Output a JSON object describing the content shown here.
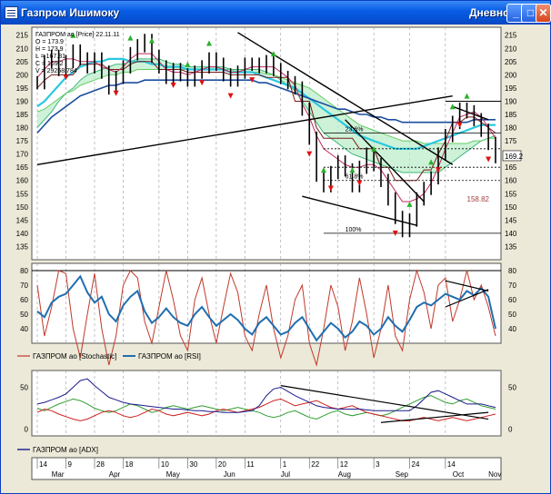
{
  "window": {
    "title": "Газпром Ишимоку",
    "timeframe": "Дневной",
    "min_glyph": "_",
    "max_glyph": "□",
    "close_glyph": "✕"
  },
  "colors": {
    "close": "#000000",
    "cloud": "#3cb878",
    "blue_ma": "#1a4ea0",
    "cyan_ma": "#29c8e0",
    "kijun": "#7a1a1a",
    "tenkan": "#c02860",
    "stoch": "#c0392b",
    "rsi": "#1f6fb0",
    "adx": "#1a1a8a",
    "di_plus": "#2e9e2e",
    "di_minus": "#d02020",
    "up_arrow": "#2ab02a",
    "down_arrow": "#e01010"
  },
  "chart_data": [
    {
      "type": "line",
      "title": "ГАЗПРОМ ао [Price] 22.11.11",
      "info": [
        "O = 173.9",
        "H = 173.9",
        "L = 167.81",
        "C = 169.2",
        "V = 29258.784"
      ],
      "ylim": [
        130,
        218
      ],
      "yticks": [
        215,
        210,
        205,
        200,
        195,
        190,
        185,
        180,
        175,
        170,
        165,
        160,
        155,
        150,
        145,
        140,
        135
      ],
      "series": [
        {
          "role": "close",
          "values": [
            197,
            205,
            207,
            202,
            205,
            209,
            206,
            203,
            206,
            201,
            195,
            199,
            203,
            208,
            211,
            213,
            207,
            203,
            199,
            202,
            200,
            198,
            201,
            203,
            206,
            204,
            200,
            198,
            201,
            204,
            204,
            203,
            205,
            202,
            199,
            197,
            195,
            187,
            176,
            162,
            158,
            163,
            167,
            164,
            158,
            165,
            170,
            166,
            160,
            153,
            146,
            141,
            145,
            153,
            157,
            161,
            170,
            177,
            182,
            187,
            186,
            183,
            179,
            174,
            169
          ]
        },
        {
          "role": "blue_ma",
          "values": [
            178,
            181,
            184,
            186,
            188,
            190,
            192,
            193,
            194,
            195,
            196,
            196,
            197,
            197,
            197,
            198,
            198,
            198,
            198,
            198,
            198,
            198,
            198,
            198,
            198,
            198,
            198,
            198,
            198,
            198,
            198,
            197,
            197,
            196,
            195,
            194,
            193,
            192,
            191,
            190,
            189,
            188,
            187,
            187,
            186,
            185,
            185,
            184,
            184,
            183,
            183,
            182,
            182,
            182,
            182,
            182,
            182,
            182,
            182,
            182,
            182,
            183,
            183,
            183,
            183
          ]
        },
        {
          "role": "cyan_ma",
          "values": [
            188,
            190,
            193,
            196,
            199,
            201,
            203,
            204,
            205,
            205,
            206,
            206,
            206,
            205,
            205,
            205,
            204,
            204,
            203,
            203,
            203,
            202,
            202,
            202,
            202,
            202,
            202,
            201,
            201,
            201,
            201,
            200,
            199,
            198,
            197,
            196,
            195,
            193,
            191,
            189,
            187,
            185,
            183,
            181,
            179,
            177,
            176,
            175,
            174,
            173,
            172,
            172,
            172,
            172,
            173,
            174,
            175,
            176,
            177,
            178,
            179,
            180,
            181,
            181,
            181
          ]
        },
        {
          "role": "kijun",
          "values": [
            195,
            198,
            200,
            200,
            200,
            200,
            204,
            204,
            204,
            204,
            202,
            202,
            202,
            204,
            205,
            205,
            205,
            202,
            202,
            202,
            202,
            201,
            201,
            201,
            201,
            201,
            201,
            200,
            200,
            200,
            200,
            200,
            199,
            199,
            199,
            199,
            190,
            190,
            190,
            180,
            176,
            176,
            176,
            176,
            176,
            172,
            172,
            172,
            165,
            165,
            160,
            160,
            160,
            160,
            164,
            164,
            170,
            175,
            182,
            182,
            184,
            184,
            182,
            180,
            178
          ]
        },
        {
          "role": "tenkan",
          "values": [
            199,
            202,
            205,
            205,
            206,
            206,
            205,
            205,
            205,
            203,
            202,
            201,
            203,
            206,
            208,
            208,
            208,
            205,
            202,
            201,
            201,
            200,
            201,
            202,
            203,
            203,
            202,
            201,
            201,
            202,
            203,
            203,
            203,
            203,
            201,
            199,
            196,
            189,
            184,
            177,
            172,
            170,
            168,
            166,
            165,
            165,
            166,
            166,
            164,
            160,
            156,
            152,
            152,
            153,
            155,
            159,
            165,
            172,
            178,
            184,
            185,
            186,
            184,
            180,
            176
          ]
        },
        {
          "role": "span_a",
          "values": [
            180,
            183,
            186,
            190,
            193,
            195,
            198,
            200,
            201,
            202,
            203,
            204,
            204,
            205,
            206,
            206,
            206,
            206,
            205,
            204,
            204,
            203,
            203,
            203,
            203,
            203,
            203,
            202,
            202,
            202,
            202,
            202,
            201,
            200,
            198,
            196,
            194,
            190,
            186,
            182,
            178,
            176,
            174,
            172,
            170,
            169,
            168,
            167,
            166,
            165,
            164,
            163,
            163,
            163,
            163,
            163,
            163,
            165,
            167,
            169,
            171,
            173,
            175,
            176,
            177
          ]
        },
        {
          "role": "span_b",
          "values": [
            186,
            187,
            189,
            191,
            193,
            194,
            196,
            197,
            198,
            199,
            200,
            200,
            201,
            201,
            202,
            202,
            202,
            202,
            202,
            202,
            202,
            202,
            202,
            202,
            202,
            202,
            202,
            202,
            201,
            201,
            201,
            201,
            200,
            200,
            199,
            198,
            197,
            196,
            195,
            193,
            191,
            189,
            187,
            185,
            183,
            181,
            180,
            179,
            178,
            177,
            176,
            175,
            175,
            175,
            174,
            174,
            174,
            174,
            174,
            174,
            174,
            175,
            175,
            176,
            176
          ]
        }
      ],
      "buy_signals_idx": [
        5,
        13,
        16,
        21,
        24,
        33,
        40,
        44,
        47,
        52,
        55,
        58,
        60
      ],
      "sell_signals_idx": [
        4,
        11,
        19,
        23,
        27,
        30,
        38,
        41,
        45,
        50,
        56,
        59,
        63
      ],
      "price_label": "169.2",
      "level_label": "158.82",
      "fib_labels": [
        "23.6%",
        "61.8%",
        "100%"
      ]
    },
    {
      "type": "line",
      "legend": [
        "ГАЗПРОМ ао [Stochastic]",
        "ГАЗПРОМ ао [RSI]"
      ],
      "ylim": [
        30,
        85
      ],
      "yticks": [
        80,
        70,
        60,
        50,
        40
      ],
      "series": [
        {
          "role": "stochastic",
          "values": [
            70,
            35,
            55,
            80,
            78,
            40,
            20,
            50,
            78,
            40,
            15,
            35,
            70,
            80,
            75,
            45,
            30,
            55,
            80,
            60,
            35,
            25,
            60,
            75,
            50,
            30,
            55,
            78,
            65,
            35,
            25,
            50,
            70,
            40,
            20,
            35,
            60,
            70,
            30,
            15,
            40,
            70,
            55,
            25,
            45,
            75,
            50,
            20,
            40,
            70,
            35,
            25,
            60,
            80,
            65,
            40,
            70,
            75,
            45,
            60,
            80,
            60,
            70,
            55,
            35
          ]
        },
        {
          "role": "rsi",
          "values": [
            52,
            48,
            58,
            62,
            64,
            70,
            76,
            65,
            58,
            62,
            50,
            45,
            56,
            62,
            66,
            52,
            44,
            48,
            54,
            48,
            44,
            42,
            50,
            55,
            48,
            42,
            46,
            50,
            46,
            40,
            36,
            44,
            48,
            42,
            36,
            38,
            44,
            48,
            40,
            32,
            38,
            44,
            40,
            34,
            38,
            45,
            42,
            36,
            40,
            48,
            42,
            38,
            46,
            55,
            58,
            56,
            60,
            64,
            62,
            60,
            66,
            63,
            68,
            62,
            40
          ]
        }
      ]
    },
    {
      "type": "line",
      "legend": [
        "ГАЗПРОМ ао [ADX]"
      ],
      "ylim": [
        -8,
        70
      ],
      "yticks": [
        50,
        0
      ],
      "x_day_labels": [
        "14",
        "9",
        "28",
        "18",
        "10",
        "30",
        "20",
        "11",
        "1",
        "22",
        "12",
        "3",
        "24",
        "14"
      ],
      "x_month_labels": [
        "Mar",
        "Apr",
        "May",
        "Jun",
        "Jul",
        "Aug",
        "Sep",
        "Oct",
        "Nov"
      ],
      "series": [
        {
          "role": "adx",
          "values": [
            30,
            32,
            35,
            38,
            42,
            50,
            58,
            60,
            52,
            45,
            38,
            35,
            32,
            30,
            29,
            28,
            27,
            26,
            25,
            24,
            24,
            23,
            22,
            22,
            21,
            21,
            20,
            20,
            20,
            21,
            22,
            28,
            40,
            48,
            50,
            45,
            40,
            36,
            32,
            28,
            26,
            25,
            24,
            24,
            24,
            24,
            23,
            22,
            22,
            22,
            22,
            22,
            22,
            28,
            36,
            44,
            46,
            42,
            38,
            34,
            30,
            30,
            30,
            28,
            26
          ]
        },
        {
          "role": "di_plus",
          "values": [
            25,
            22,
            26,
            30,
            33,
            36,
            34,
            30,
            25,
            22,
            20,
            22,
            26,
            30,
            28,
            24,
            20,
            22,
            26,
            28,
            26,
            24,
            26,
            28,
            26,
            24,
            22,
            24,
            26,
            24,
            22,
            20,
            16,
            14,
            16,
            20,
            22,
            18,
            14,
            12,
            16,
            20,
            22,
            18,
            16,
            18,
            20,
            18,
            16,
            18,
            22,
            26,
            30,
            34,
            38,
            40,
            36,
            32,
            30,
            34,
            36,
            32,
            28,
            26,
            24
          ]
        },
        {
          "role": "di_minus",
          "values": [
            20,
            24,
            22,
            18,
            15,
            12,
            10,
            12,
            16,
            20,
            22,
            20,
            16,
            14,
            16,
            20,
            24,
            22,
            18,
            16,
            18,
            20,
            18,
            16,
            18,
            22,
            24,
            22,
            20,
            22,
            24,
            26,
            30,
            34,
            36,
            32,
            28,
            30,
            32,
            34,
            30,
            26,
            24,
            26,
            28,
            24,
            20,
            18,
            16,
            14,
            12,
            10,
            10,
            12,
            14,
            12,
            10,
            12,
            14,
            12,
            10,
            12,
            14,
            16,
            18
          ]
        }
      ]
    }
  ]
}
